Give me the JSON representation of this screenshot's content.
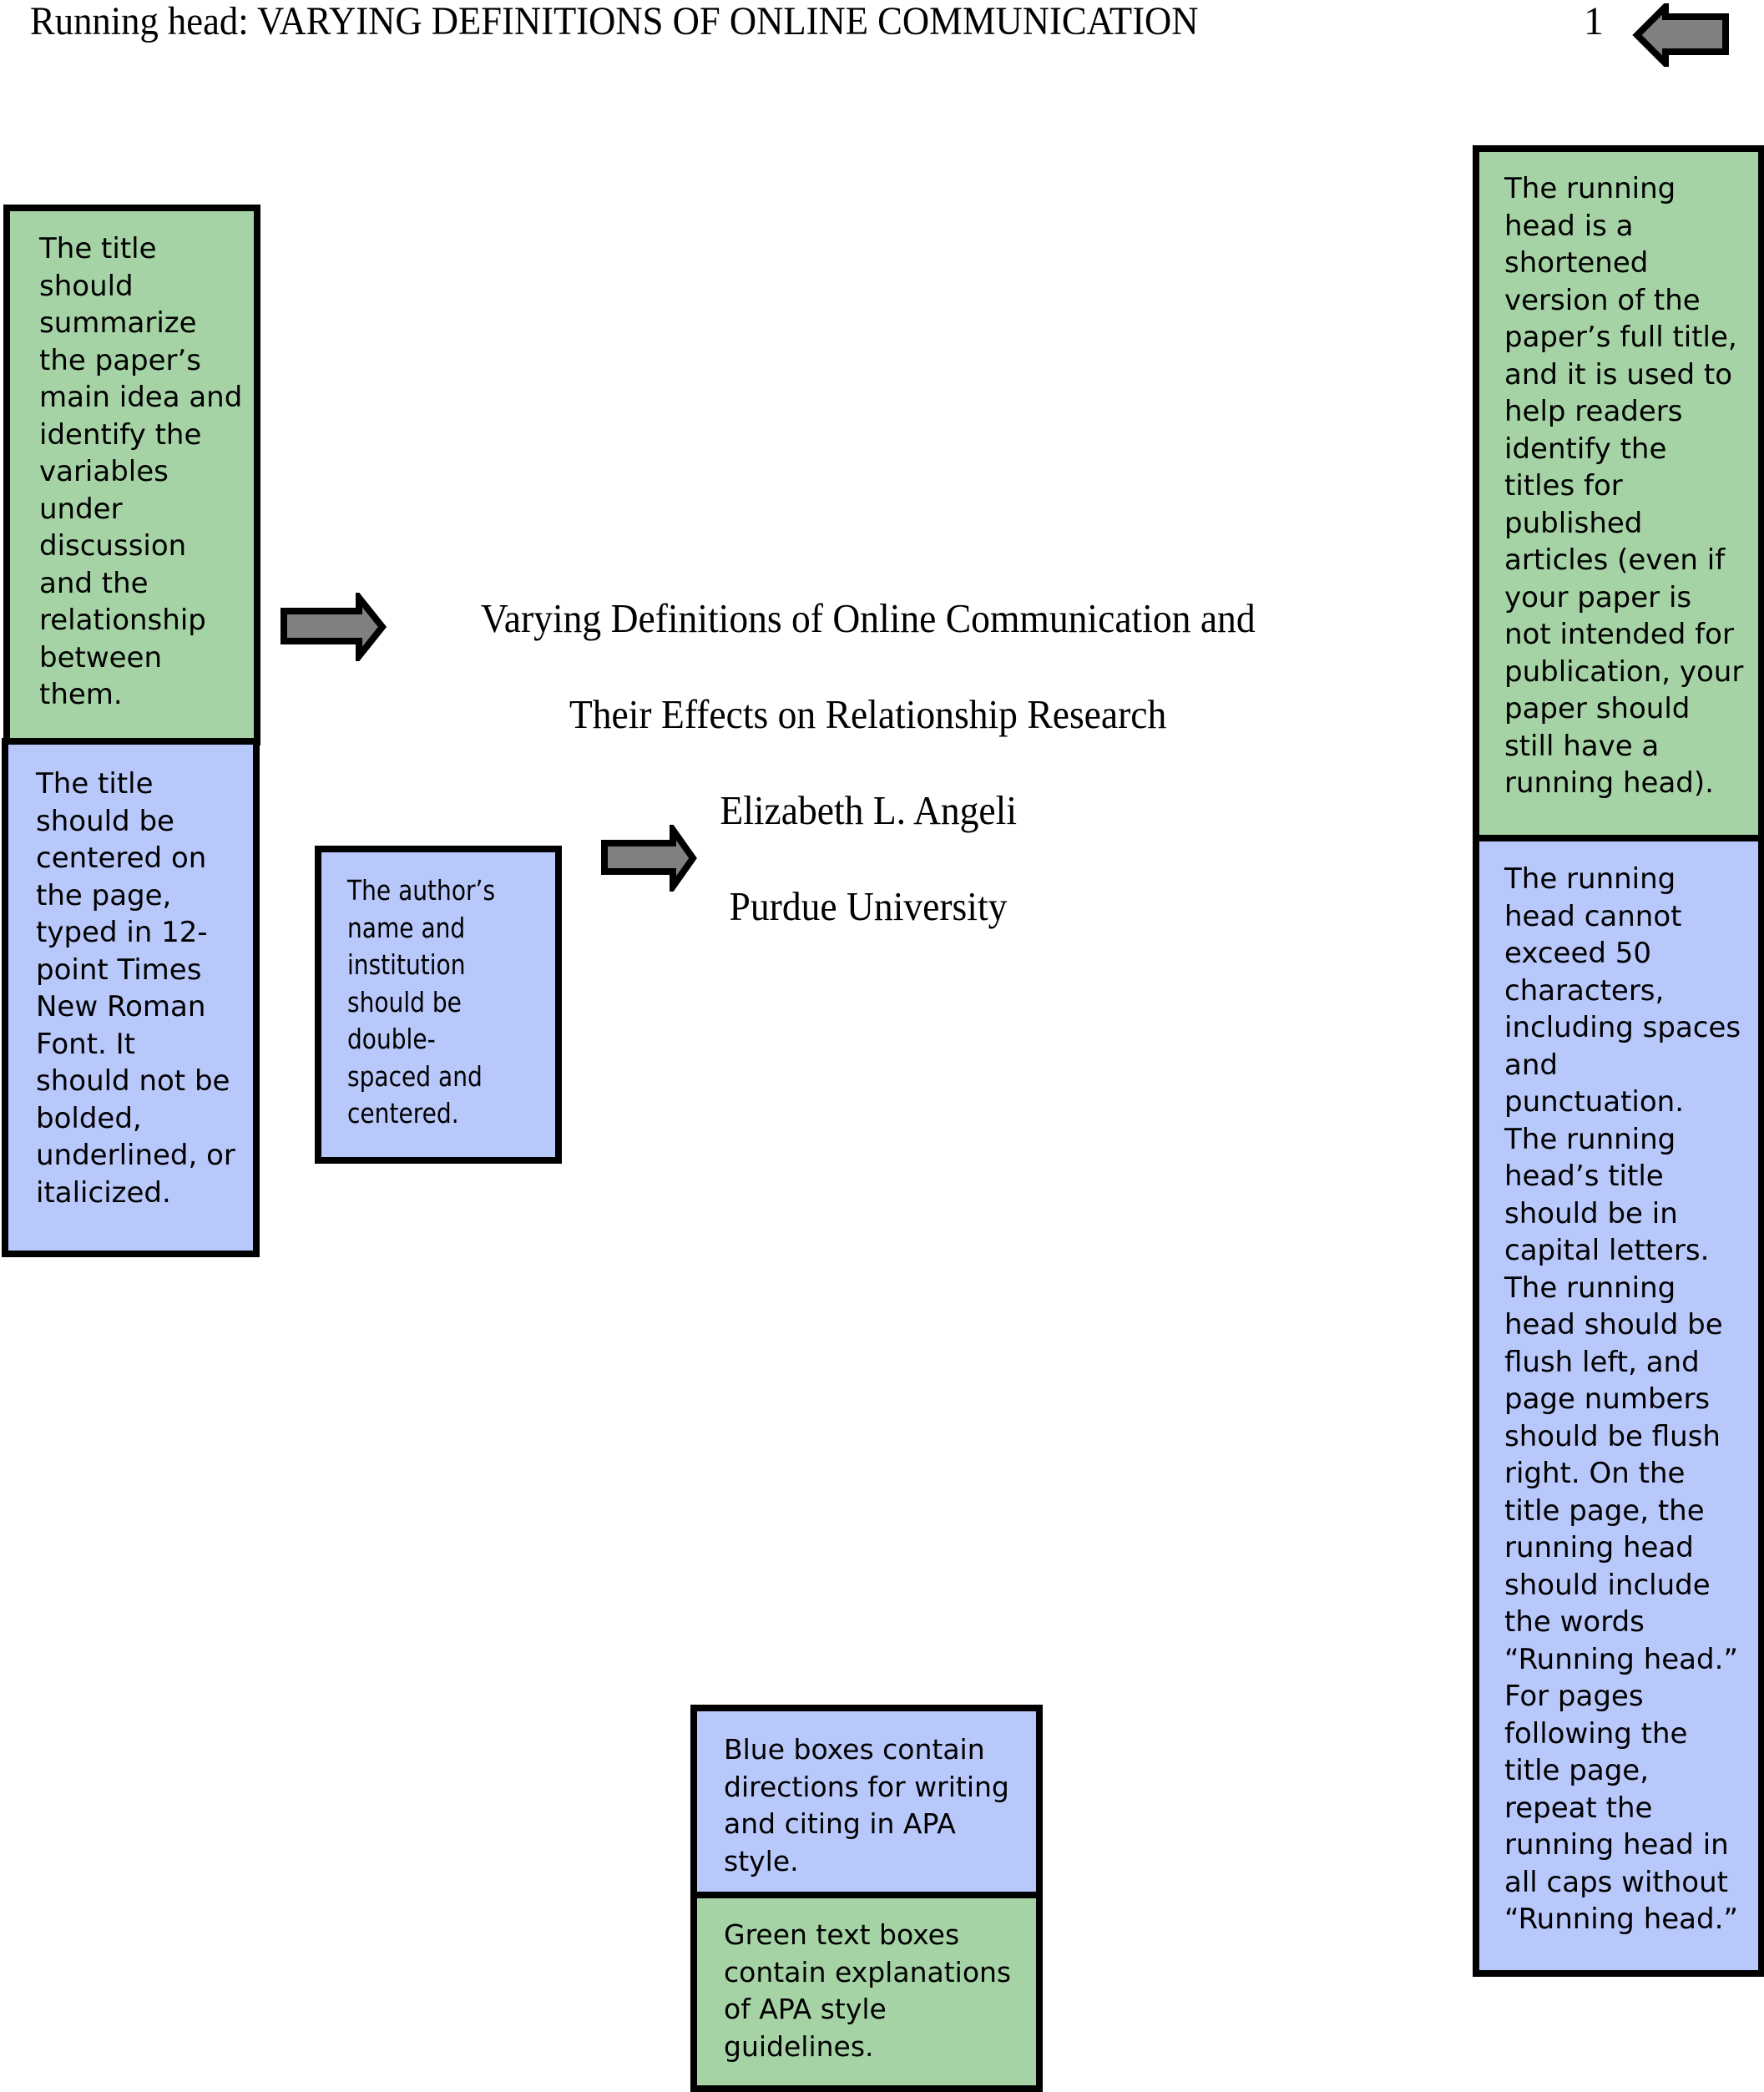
{
  "header": {
    "running_head": "Running head: VARYING DEFINITIONS OF ONLINE COMMUNICATION",
    "page_number": "1"
  },
  "title_block": {
    "title_line_1": "Varying Definitions of Online Communication and",
    "title_line_2": "Their Effects on Relationship Research",
    "author": "Elizabeth L. Angeli",
    "institution": "Purdue University"
  },
  "annotations": {
    "title_explanation": {
      "color": "green",
      "text": "The title\nshould\nsummarize\nthe paper’s\nmain idea and\nidentify the\nvariables\nunder\ndiscussion\nand the\nrelationship\nbetween\nthem."
    },
    "title_directions": {
      "color": "blue",
      "text": "The title\nshould be\ncentered on\nthe page,\ntyped in 12-\npoint Times\nNew Roman\nFont. It\nshould not be\nbolded,\nunderlined, or\nitalicized."
    },
    "author_directions": {
      "color": "blue",
      "text": "The author’s\nname and\ninstitution\nshould be\ndouble-\nspaced and\ncentered."
    },
    "running_head_explanation": {
      "color": "green",
      "text": "The running\nhead is a\nshortened\nversion of the\npaper’s full title,\nand it is used to\nhelp readers\nidentify the\ntitles for\npublished\narticles (even if\nyour paper is\nnot intended for\npublication, your\npaper should\nstill have a\nrunning head)."
    },
    "running_head_directions": {
      "color": "blue",
      "text": "The running\nhead cannot\nexceed 50\ncharacters,\nincluding spaces\nand\npunctuation.\nThe running\nhead’s title\nshould be in\ncapital letters.\nThe running\nhead should be\nflush left, and\npage numbers\nshould be flush\nright. On the\ntitle page, the\nrunning head\nshould include\nthe words\n“Running head.”\nFor pages\nfollowing the\ntitle page,\nrepeat the\nrunning head in\nall caps without\n“Running head.”"
    }
  },
  "legend": {
    "blue_text": "Blue boxes contain\ndirections for writing\nand citing in APA\nstyle.",
    "green_text": "Green text boxes\ncontain explanations\nof APA style\nguidelines."
  },
  "colors": {
    "green_box": "#a5d3a5",
    "blue_box": "#b8c8fb",
    "arrow_fill": "#808080",
    "border": "#000000"
  },
  "icons": {
    "header_arrow": "arrow-left-icon",
    "title_arrow": "arrow-right-icon",
    "author_arrow": "arrow-right-icon"
  }
}
